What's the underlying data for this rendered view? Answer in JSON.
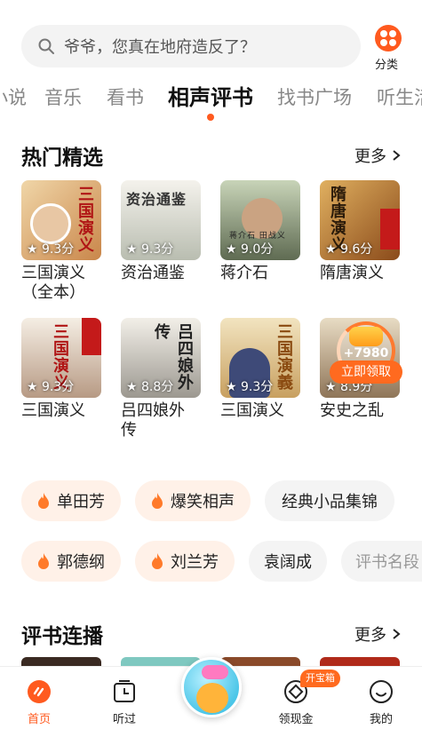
{
  "search": {
    "placeholder": "爷爷，您真在地府造反了？"
  },
  "category_button": {
    "label": "分类"
  },
  "tabs": [
    {
      "label": "小说"
    },
    {
      "label": "音乐"
    },
    {
      "label": "看书"
    },
    {
      "label": "相声评书",
      "active": true
    },
    {
      "label": "找书广场"
    },
    {
      "label": "听生活"
    }
  ],
  "hot_section": {
    "title": "热门精选",
    "more": "更多",
    "books": [
      {
        "title": "三国演义\n（全本）",
        "rating": "9.3分",
        "cover_text": "三国演义",
        "cover_bg": "#d9a46a"
      },
      {
        "title": "资治通鉴",
        "rating": "9.3分",
        "cover_text": "资治通鉴",
        "cover_bg": "#cfd2c8"
      },
      {
        "title": "蒋介石",
        "rating": "9.0分",
        "cover_text": "蒋介石 田战义",
        "cover_bg": "#9aa88a"
      },
      {
        "title": "隋唐演义",
        "rating": "9.6分",
        "cover_text": "隋唐演义",
        "cover_bg": "#c98a3a"
      },
      {
        "title": "三国演义",
        "rating": "9.3分",
        "cover_text": "三国演义",
        "cover_bg": "#e8ddd0"
      },
      {
        "title": "吕四娘外\n传",
        "rating": "8.8分",
        "cover_text": "吕四娘外传",
        "cover_bg": "#d8d4cc"
      },
      {
        "title": "三国演义",
        "rating": "9.3分",
        "cover_text": "三国演義",
        "cover_bg": "#e6d3a8"
      },
      {
        "title": "安史之乱",
        "rating": "8.9分",
        "cover_text": "",
        "cover_bg": "#c9b89a"
      }
    ]
  },
  "reward": {
    "amount": "+7980",
    "button": "立即领取"
  },
  "tags_row1": [
    {
      "label": "单田芳",
      "hot": true
    },
    {
      "label": "爆笑相声",
      "hot": true
    },
    {
      "label": "经典小品集锦",
      "hot": false
    }
  ],
  "tags_row2": [
    {
      "label": "郭德纲",
      "hot": true
    },
    {
      "label": "刘兰芳",
      "hot": true
    },
    {
      "label": "袁阔成",
      "hot": false
    },
    {
      "label": "评书名段",
      "hot": false
    }
  ],
  "serial_section": {
    "title": "评书连播",
    "more": "更多"
  },
  "bottom_nav": {
    "home": "首页",
    "listened": "听过",
    "cash": "领现金",
    "mine": "我的",
    "badge": "开宝箱"
  },
  "colors": {
    "accent": "#ff5a1f",
    "chip_hot": "#fff1e8",
    "chip_plain": "#f4f4f4"
  }
}
